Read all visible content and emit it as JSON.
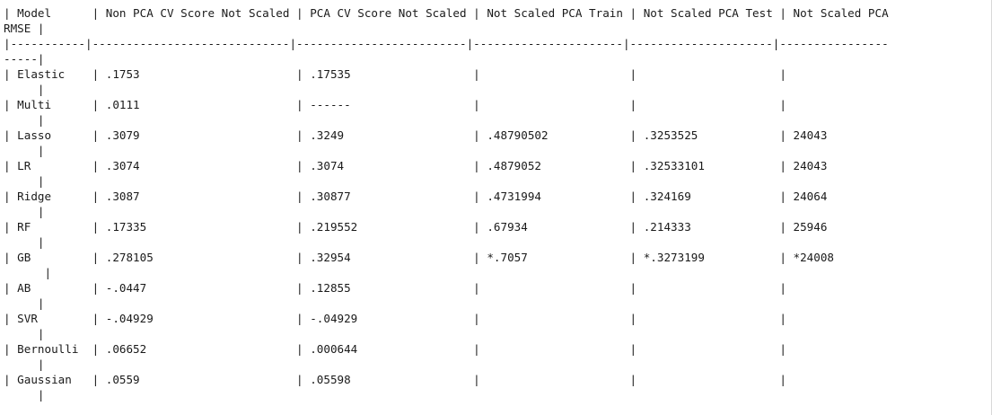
{
  "lines": [
    "| Model      | Non PCA CV Score Not Scaled | PCA CV Score Not Scaled | Not Scaled PCA Train | Not Scaled PCA Test | Not Scaled PCA",
    "RMSE |",
    "|-----------|-----------------------------|-------------------------|----------------------|---------------------|----------------",
    "-----|",
    "| Elastic    | .1753                       | .17535                  |                      |                     |",
    "     |",
    "| Multi      | .0111                       | ------                  |                      |                     |",
    "     |",
    "| Lasso      | .3079                       | .3249                   | .48790502            | .3253525            | 24043",
    "     |",
    "| LR         | .3074                       | .3074                   | .4879052             | .32533101           | 24043",
    "     |",
    "| Ridge      | .3087                       | .30877                  | .4731994             | .324169             | 24064",
    "     |",
    "| RF         | .17335                      | .219552                 | .67934               | .214333             | 25946",
    "     |",
    "| GB         | .278105                     | .32954                  | *.7057               | *.3273199           | *24008",
    "      |",
    "| AB         | -.0447                      | .12855                  |                      |                     |",
    "     |",
    "| SVR        | -.04929                     | -.04929                 |                      |                     |",
    "     |",
    "| Bernoulli  | .06652                      | .000644                 |                      |                     |",
    "     |",
    "| Gaussian   | .0559                       | .05598                  |                      |                     |",
    "     |"
  ]
}
